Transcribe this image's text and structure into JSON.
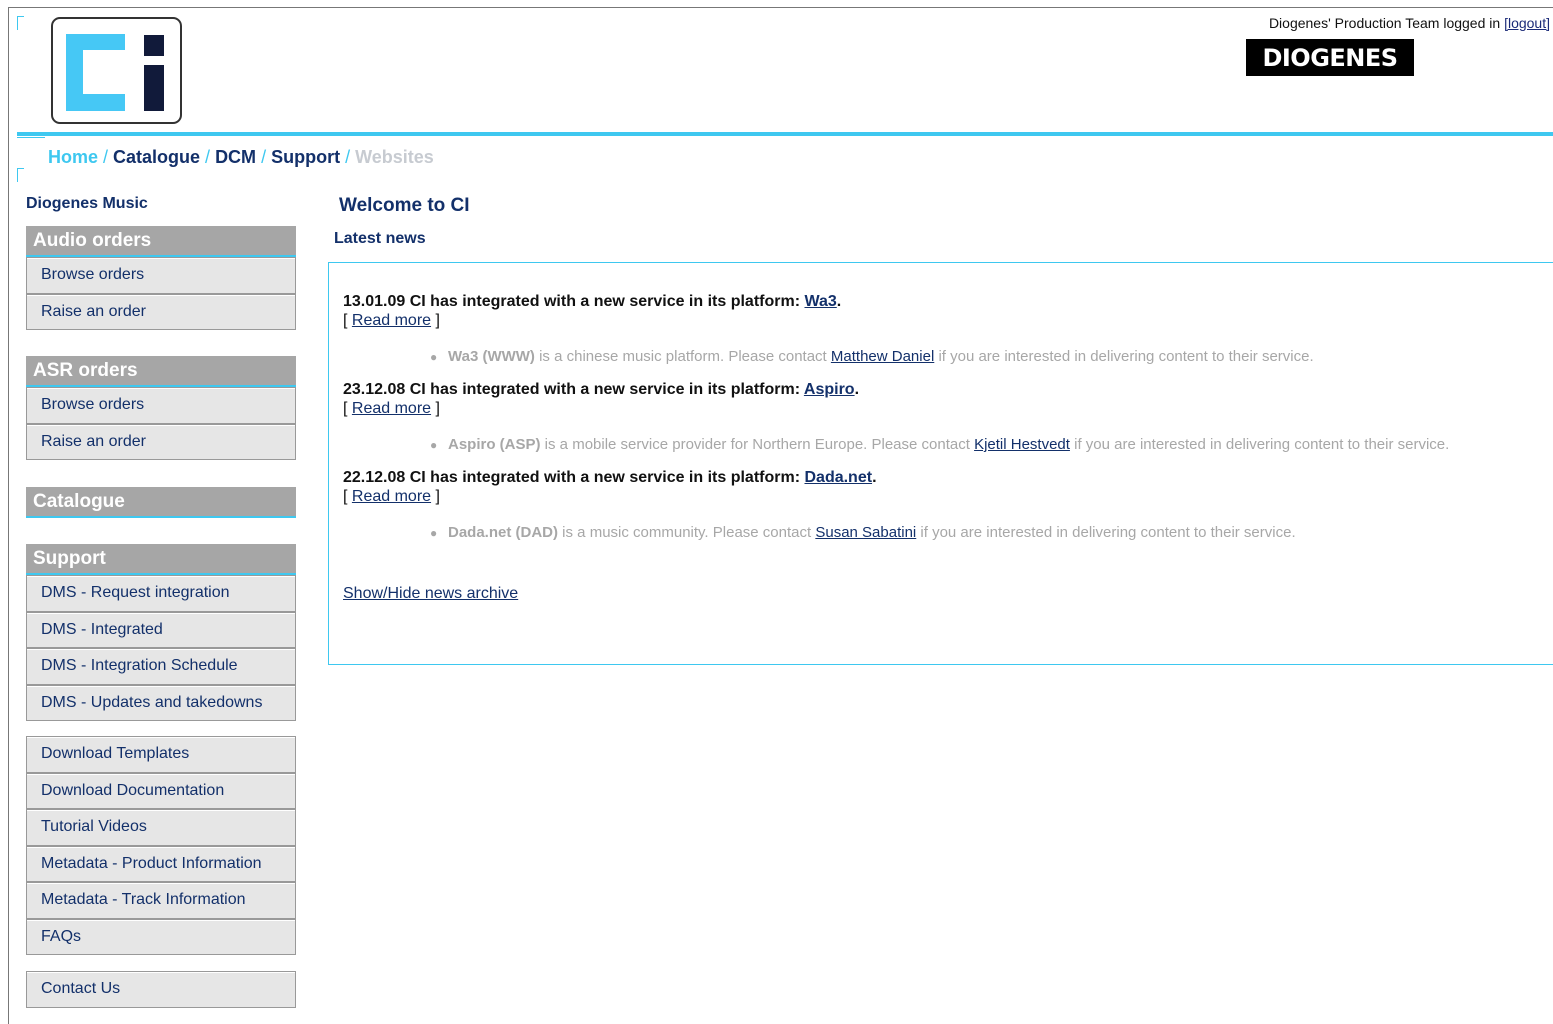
{
  "header": {
    "user_text": "Diogenes' Production Team logged in",
    "logout_label": "[logout]",
    "brand_name": "DIOGENES",
    "logo_alt": "CI logo",
    "colors": {
      "accent": "#3ec8f0",
      "navy": "#13306a",
      "gray_head": "#a6a6a6",
      "light": "#e6e6e6"
    }
  },
  "breadcrumb": {
    "home": "Home",
    "items": [
      "Catalogue",
      "DCM",
      "Support"
    ],
    "current": "Websites",
    "separator": "/"
  },
  "sidebar": {
    "title": "Diogenes Music",
    "audio": {
      "heading": "Audio orders",
      "items": [
        "Browse orders",
        "Raise an order"
      ]
    },
    "asr": {
      "heading": "ASR orders",
      "items": [
        "Browse orders",
        "Raise an order"
      ]
    },
    "catalogue": {
      "heading": "Catalogue"
    },
    "support": {
      "heading": "Support",
      "items": [
        "DMS - Request integration",
        "DMS - Integrated",
        "DMS - Integration Schedule",
        "DMS - Updates and takedowns"
      ]
    },
    "downloads": {
      "items": [
        "Download Templates",
        "Download Documentation",
        "Tutorial Videos",
        "Metadata - Product Information",
        "Metadata - Track Information",
        "FAQs"
      ]
    },
    "contact": {
      "items": [
        "Contact Us"
      ]
    }
  },
  "main": {
    "title": "Welcome to CI",
    "latest": "Latest news",
    "read_more_open": "[",
    "read_more": "Read more",
    "read_more_close": "]",
    "archive": "Show/Hide news archive",
    "news": [
      {
        "headline": "13.01.09 CI has integrated with a new service in its platform: ",
        "service": "Wa3",
        "body_bold": "Wa3 (WWW)",
        "body_pre": " is a chinese music platform. Please contact ",
        "contact": "Matthew Daniel",
        "body_post": " if you are interested in delivering content to their service."
      },
      {
        "headline": "23.12.08 CI has integrated with a new service in its platform: ",
        "service": "Aspiro",
        "body_bold": "Aspiro (ASP)",
        "body_pre": " is a mobile service provider for Northern Europe. Please contact ",
        "contact": "Kjetil Hestvedt",
        "body_post": " if you are interested in delivering content to their service."
      },
      {
        "headline": "22.12.08 CI has integrated with a new service in its platform: ",
        "service": "Dada.net",
        "body_bold": "Dada.net (DAD)",
        "body_pre": " is a music community. Please contact ",
        "contact": "Susan Sabatini",
        "body_post": " if you are interested in delivering content to their service."
      }
    ]
  }
}
